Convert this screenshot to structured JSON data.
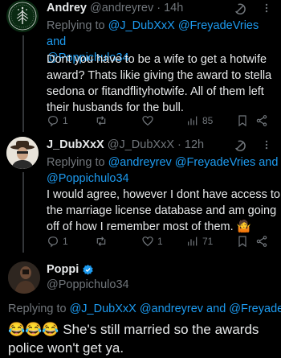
{
  "tweets": [
    {
      "name": "Andrey",
      "handle": "@andreyrev",
      "dot": "·",
      "time": "14h",
      "reply_prefix": "Replying to",
      "reply_mentions_1": "@J_DubXxX @FreyadeVries and",
      "reply_mentions_2": "@Poppichulo34",
      "text_lines": [
        "Dont you have to be a wife to get a hotwife",
        "award? Thats likie giving the award to stella",
        "sedona or fitandflityhotwife. All of them left",
        "their husbands for the bull."
      ],
      "reply_count": "1",
      "retweet_count": "",
      "like_count": "",
      "view_count": "85"
    },
    {
      "name": "J_DubXxX",
      "handle": "@J_DubXxX",
      "dot": "·",
      "time": "12h",
      "reply_prefix": "Replying to",
      "reply_mentions_1": "@andreyrev @FreyadeVries and",
      "reply_mentions_2": "@Poppichulo34",
      "text_lines": [
        "I would agree, however I dont have access to",
        "the marriage license database and am going",
        "off of how I remember most of them. 🤷"
      ],
      "reply_count": "1",
      "retweet_count": "",
      "like_count": "1",
      "view_count": "71"
    }
  ],
  "focused": {
    "name": "Poppi",
    "handle": "@Poppichulo34",
    "reply_prefix": "Replying to",
    "reply_mentions": "@J_DubXxX @andreyrev and @FreyadeVries",
    "text_line_1": "😂😂😂 She's still married so the awards",
    "text_line_2": "police won't get ya."
  },
  "colors": {
    "background": "#000000",
    "accent": "#1d9bf0",
    "muted": "#71767b",
    "verified": "#1d9bf0"
  },
  "icons": [
    "grok-icon",
    "more-icon",
    "reply-icon",
    "retweet-icon",
    "like-icon",
    "views-icon",
    "bookmark-icon",
    "share-icon",
    "verified-badge-icon"
  ]
}
